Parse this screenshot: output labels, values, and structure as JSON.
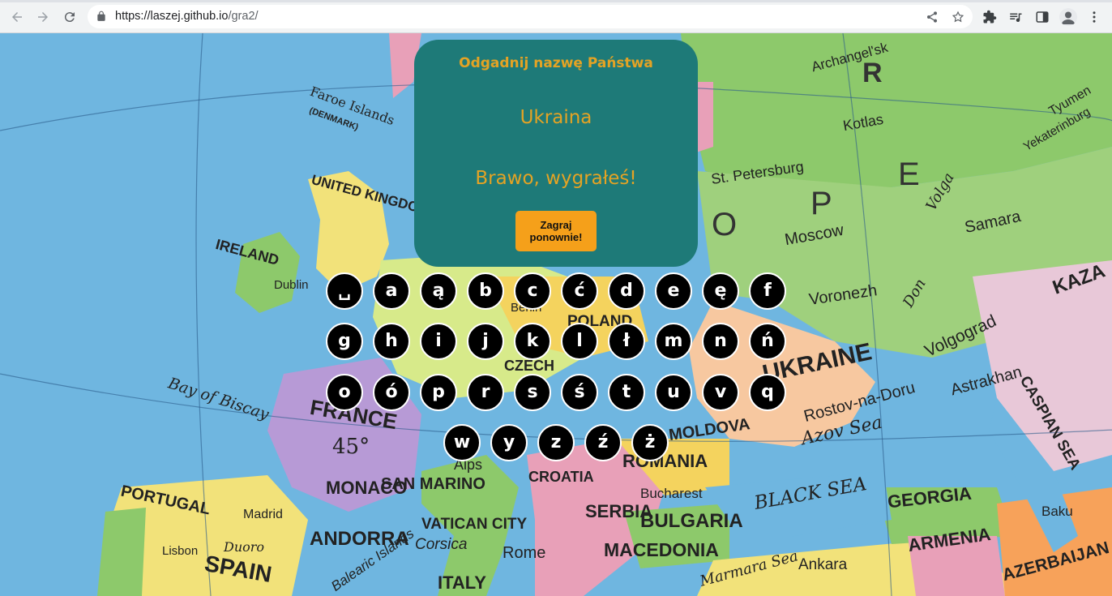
{
  "browser": {
    "url_host": "https://laszej.github.io",
    "url_path": "/gra2/",
    "icons": [
      "back-icon",
      "forward-icon",
      "reload-icon",
      "lock-icon",
      "share-icon",
      "star-icon",
      "extensions-icon",
      "media-icon",
      "side-panel-icon",
      "profile-icon",
      "menu-icon"
    ]
  },
  "map": {
    "labels": [
      "Faroe Islands",
      "(DENMARK)",
      "UNITED KINGDOM",
      "IRELAND",
      "Dublin",
      "Bay of Biscay",
      "FRANCE",
      "45°",
      "PORTUGAL",
      "Madrid",
      "Duoro",
      "SPAIN",
      "Lisbon",
      "ANDORRA",
      "MONACO",
      "SAN MARINO",
      "VATICAN CITY",
      "Corsica",
      "Rome",
      "ITALY",
      "Balearic Islands",
      "CROATIA",
      "SERBIA",
      "BULGARIA",
      "MACEDONIA",
      "ROMANIA",
      "MOLDOVA",
      "Bucharest",
      "BLACK SEA",
      "Marmara Sea",
      "Ankara",
      "GEORGIA",
      "ARMENIA",
      "AZERBAIJAN",
      "Baku",
      "CASPIAN SEA",
      "Azov Sea",
      "Rostov-na-Doru",
      "Astrakhan",
      "Volgograd",
      "UKRAINE",
      "Voronezh",
      "Don",
      "Moscow",
      "Samara",
      "Volga",
      "St. Petersburg",
      "Kotlas",
      "Archangel'sk",
      "Tyumen",
      "Yekaterinburg",
      "KAZA",
      "E",
      "P",
      "O",
      "R",
      "POLAND",
      "CZECH",
      "Alps",
      "Berlin"
    ],
    "colors": {
      "sea": "#6fb6e0",
      "land_green": "#8dc96b",
      "land_yellow": "#f2e27a",
      "land_pink": "#e8a0b8",
      "land_purple": "#b79ad6"
    }
  },
  "game": {
    "title": "Odgadnij nazwę Państwa",
    "answer": "Ukraina",
    "message": "Brawo, wygrałeś!",
    "play_again": "Zagraj ponownie!",
    "colors": {
      "panel": "#1e7a78",
      "text": "#e4a324",
      "button": "#f5a01a"
    }
  },
  "keyboard": {
    "rows": [
      [
        "␣",
        "a",
        "ą",
        "b",
        "c",
        "ć",
        "d",
        "e",
        "ę",
        "f"
      ],
      [
        "g",
        "h",
        "i",
        "j",
        "k",
        "l",
        "ł",
        "m",
        "n",
        "ń"
      ],
      [
        "o",
        "ó",
        "p",
        "r",
        "s",
        "ś",
        "t",
        "u",
        "v",
        "q"
      ],
      [
        "w",
        "y",
        "z",
        "ź",
        "ż"
      ]
    ]
  }
}
